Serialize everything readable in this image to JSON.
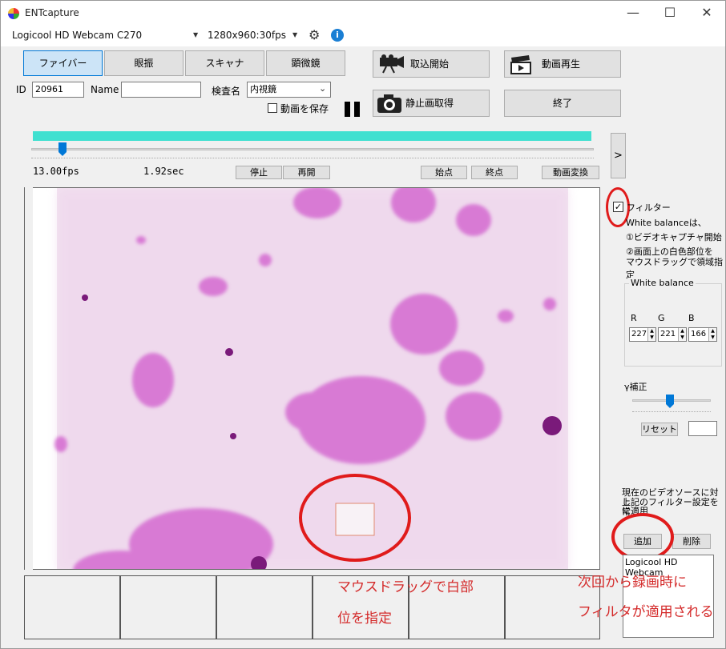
{
  "window": {
    "title": "ENTcapture",
    "min": "—",
    "max": "☐",
    "close": "✕"
  },
  "toolbar": {
    "camera": "Logicool HD Webcam C270",
    "format": "1280x960:30fps"
  },
  "tabs": [
    {
      "label": "ファイバー"
    },
    {
      "label": "眼振"
    },
    {
      "label": "スキャナ"
    },
    {
      "label": "顕微鏡"
    }
  ],
  "form": {
    "id_label": "ID",
    "id_value": "20961",
    "name_label": "Name",
    "name_value": "",
    "exam_label": "検査名",
    "exam_value": "内視鏡",
    "save_video_label": "動画を保存"
  },
  "actions": {
    "capture_start": "取込開始",
    "video_play": "動画再生",
    "still_capture": "静止画取得",
    "quit": "終了"
  },
  "playback": {
    "fps": "13.00fps",
    "time": "1.92sec",
    "stop": "停止",
    "resume": "再開",
    "start_point": "始点",
    "end_point": "終点",
    "convert": "動画変換",
    "progress": 1.0,
    "slider": 0.055
  },
  "panel": {
    "expand": ">",
    "filter_label": "フィルター",
    "filter_checked": true,
    "note1": "White balanceは、",
    "note2": "①ビデオキャプチャ開始",
    "note3": "②画面上の白色部位を",
    "note4": "マウスドラッグで領域指定",
    "wb_title": "White balance",
    "r_label": "R",
    "g_label": "G",
    "b_label": "B",
    "r_value": "227",
    "g_value": "221",
    "b_value": "166",
    "gamma_label": "γ補正",
    "gamma_level": 0.48,
    "reset": "リセット",
    "apply_note1": "現在のビデオソースに対し",
    "apply_note2": "上記のフィルター設定を常",
    "apply_note3": "に適用",
    "add": "追加",
    "delete": "削除",
    "list_item": "Logicool HD Webcam"
  },
  "annotations": {
    "drag_note_line1": "マウスドラッグで白部",
    "drag_note_line2": "位を指定",
    "record_note_line1": "次回から録画時に",
    "record_note_line2": "フィルタが適用される",
    "color": "#d42a2a"
  },
  "colors": {
    "accent": "#0078d7",
    "progress": "#40e0d0",
    "stain": "#c040c0"
  }
}
